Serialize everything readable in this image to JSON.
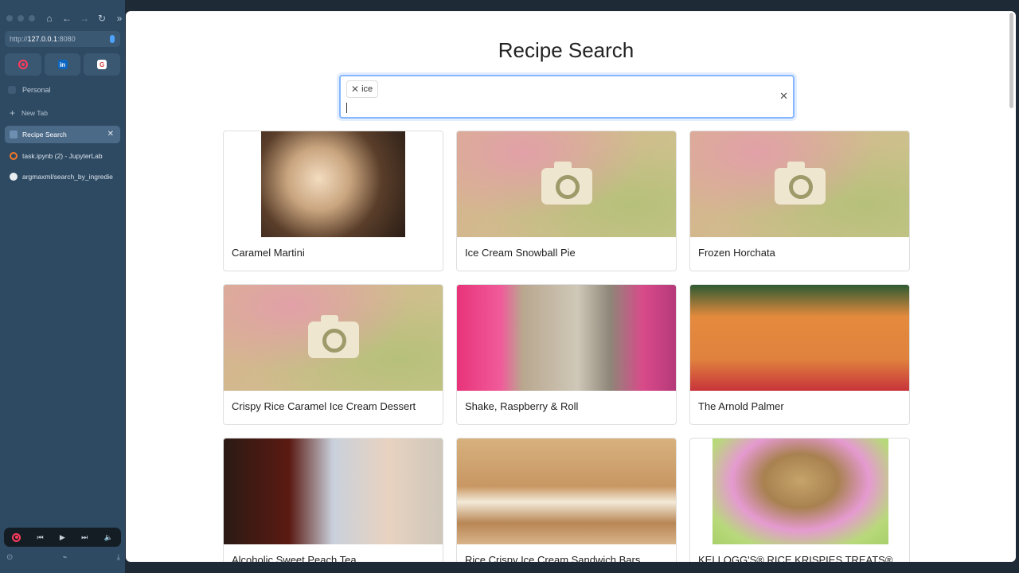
{
  "browser": {
    "url_prefix": "http://",
    "url_host": "127.0.0.1",
    "url_port": ":8080",
    "space_label": "Personal",
    "new_tab_label": "New Tab",
    "tabs": [
      {
        "label": "Recipe Search",
        "active": true
      },
      {
        "label": "task.ipynb (2) - JupyterLab",
        "active": false
      },
      {
        "label": "argmaxml/search_by_ingredie",
        "active": false
      }
    ],
    "pinned": [
      "record-icon",
      "linkedin-icon",
      "gmail-icon"
    ]
  },
  "page": {
    "title": "Recipe Search",
    "search": {
      "chips": [
        "ice"
      ],
      "query": ""
    },
    "recipes": [
      {
        "name": "Caramel Martini",
        "image": "photo"
      },
      {
        "name": "Ice Cream Snowball Pie",
        "image": "placeholder"
      },
      {
        "name": "Frozen Horchata",
        "image": "placeholder"
      },
      {
        "name": "Crispy Rice Caramel Ice Cream Dessert",
        "image": "placeholder"
      },
      {
        "name": "Shake, Raspberry & Roll",
        "image": "photo"
      },
      {
        "name": "The Arnold Palmer",
        "image": "photo"
      },
      {
        "name": "Alcoholic Sweet Peach Tea",
        "image": "photo"
      },
      {
        "name": "Rice Crispy Ice Cream Sandwich Bars",
        "image": "photo"
      },
      {
        "name": "KELLOGG'S® RICE KRISPIES TREATS®",
        "image": "photo"
      }
    ]
  }
}
